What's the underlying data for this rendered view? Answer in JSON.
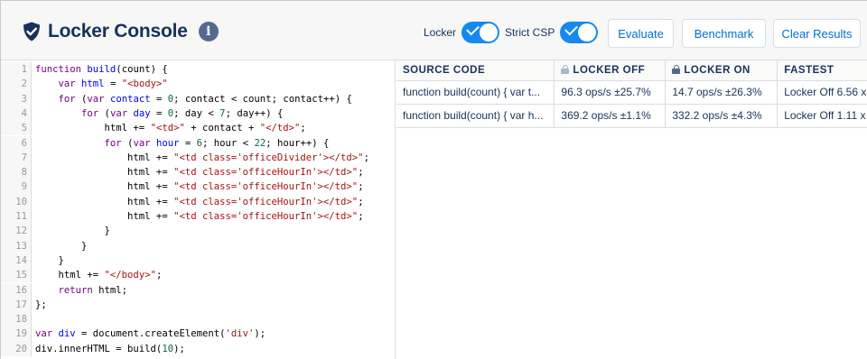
{
  "header": {
    "title": "Locker Console",
    "info_icon": "info-icon",
    "toggles": [
      {
        "label": "Locker",
        "on": true
      },
      {
        "label": "Strict CSP",
        "on": true
      }
    ],
    "buttons": {
      "evaluate": "Evaluate",
      "benchmark": "Benchmark",
      "clear": "Clear Results"
    }
  },
  "editor": {
    "lines": [
      {
        "n": "1",
        "text": "function build(count) {"
      },
      {
        "n": "2",
        "text": "    var html = \"<body>\""
      },
      {
        "n": "3",
        "text": "    for (var contact = 0; contact < count; contact++) {"
      },
      {
        "n": "4",
        "text": "        for (var day = 0; day < 7; day++) {"
      },
      {
        "n": "5",
        "text": "            html += \"<td>\" + contact + \"</td>\";"
      },
      {
        "n": "6",
        "text": "            for (var hour = 6; hour < 22; hour++) {"
      },
      {
        "n": "7",
        "text": "                html += \"<td class='officeDivider'></td>\";"
      },
      {
        "n": "8",
        "text": "                html += \"<td class='officeHourIn'></td>\";"
      },
      {
        "n": "9",
        "text": "                html += \"<td class='officeHourIn'></td>\";"
      },
      {
        "n": "10",
        "text": "                html += \"<td class='officeHourIn'></td>\";"
      },
      {
        "n": "11",
        "text": "                html += \"<td class='officeHourIn'></td>\";"
      },
      {
        "n": "12",
        "text": "            }"
      },
      {
        "n": "13",
        "text": "        }"
      },
      {
        "n": "14",
        "text": "    }"
      },
      {
        "n": "15",
        "text": "    html += \"</body>\";"
      },
      {
        "n": "16",
        "text": "    return html;"
      },
      {
        "n": "17",
        "text": "};"
      },
      {
        "n": "18",
        "text": ""
      },
      {
        "n": "19",
        "text": "var div = document.createElement('div');"
      },
      {
        "n": "20",
        "text": "div.innerHTML = build(10);"
      }
    ]
  },
  "results": {
    "columns": [
      "SOURCE CODE",
      "LOCKER OFF",
      "LOCKER ON",
      "FASTEST"
    ],
    "rows": [
      [
        "function build(count) { var t...",
        "96.3 ops/s ±25.7%",
        "14.7 ops/s ±26.3%",
        "Locker Off 6.56 x"
      ],
      [
        "function build(count) { var h...",
        "369.2 ops/s ±1.1%",
        "332.2 ops/s ±4.3%",
        "Locker Off 1.11 x"
      ]
    ]
  },
  "colors": {
    "accent": "#1589ee",
    "link": "#0070d2",
    "text": "#16325c"
  }
}
